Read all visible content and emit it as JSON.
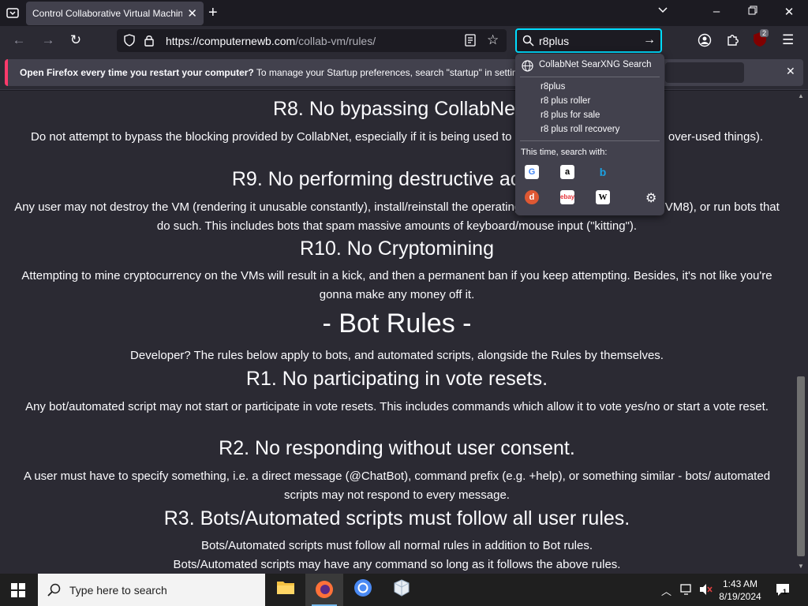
{
  "browser": {
    "tab_title": "Control Collaborative Virtual Machin",
    "url_host": "https://computernewb.com",
    "url_path": "/collab-vm/rules/",
    "search_query": "r8plus",
    "extensions_badge": "2"
  },
  "notification": {
    "bold": "Open Firefox every time you restart your computer?",
    "text": " To manage your Startup preferences, search \"startup\" in settings"
  },
  "search_dropdown": {
    "engine_label": "CollabNet SearXNG Search",
    "suggestions": [
      "r8plus",
      "r8 plus roller",
      "r8 plus for sale",
      "r8 plus roll recovery"
    ],
    "this_time_label": "This time, search with:",
    "engines": [
      "Google",
      "Amazon",
      "Bing",
      "DuckDuckGo",
      "eBay",
      "Wikipedia"
    ]
  },
  "content": {
    "r8_title": "R8. No bypassing CollabNet",
    "r8_text": "Do not attempt to bypass the blocking provided by CollabNet, especially if it is being used to enforce Rule 7 (or run stupid over-used things).",
    "r9_title": "R9. No performing destructive actions",
    "r9_text": "Any user may not destroy the VM (rendering it unusable constantly), install/reinstall the operating system (except on VM7 or VM8), or run bots that do such. This includes bots that spam massive amounts of keyboard/mouse input (\"kitting\").",
    "r10_title": "R10. No Cryptomining",
    "r10_text": "Attempting to mine cryptocurrency on the VMs will result in a kick, and then a permanent ban if you keep attempting. Besides, it's not like you're gonna make any money off it.",
    "bot_title": "- Bot Rules -",
    "bot_intro": "Developer? The rules below apply to bots, and automated scripts, alongside the Rules by themselves.",
    "b1_title": "R1. No participating in vote resets.",
    "b1_text": "Any bot/automated script may not start or participate in vote resets. This includes commands which allow it to vote yes/no or start a vote reset.",
    "b2_title": "R2. No responding without user consent.",
    "b2_text": "A user must have to specify something, i.e. a direct message (@ChatBot), command prefix (e.g. +help), or something similar - bots/ automated scripts may not respond to every message.",
    "b3_title": "R3. Bots/Automated scripts must follow all user rules.",
    "b3_text1": "Bots/Automated scripts must follow all normal rules in addition to Bot rules.",
    "b3_text2": "Bots/Automated scripts may have any command so long as it follows the above rules."
  },
  "taskbar": {
    "search_placeholder": "Type here to search",
    "time": "1:43 AM",
    "date": "8/19/2024",
    "notification_count": "1"
  }
}
